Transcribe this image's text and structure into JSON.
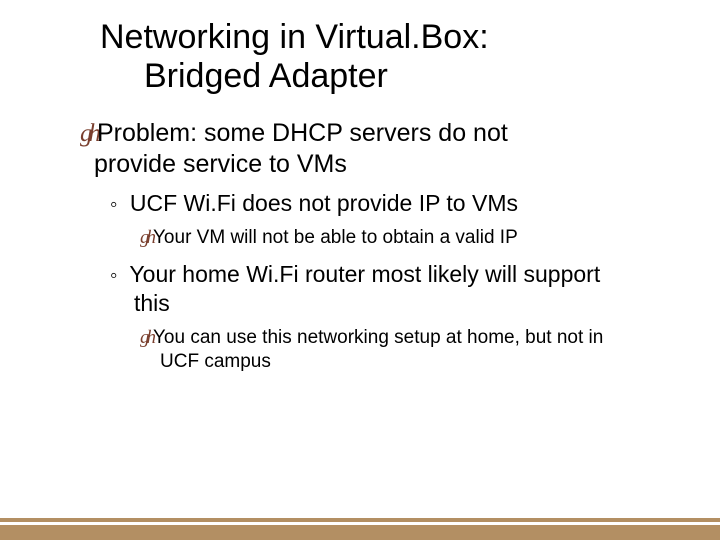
{
  "title": {
    "line1": "Networking in Virtual.Box:",
    "line2": "Bridged Adapter"
  },
  "content": {
    "p1_bullet": "gh",
    "p1_text_a": "Problem: some DHCP servers do not",
    "p1_text_b": "provide service to VMs",
    "p2_bullet": "◦",
    "p2_text": " UCF Wi.Fi does not provide IP to VMs",
    "p3_bullet": "gh",
    "p3_text": "Your VM will not be able to obtain a valid IP",
    "p4_bullet": "◦",
    "p4_text_a": " Your home Wi.Fi router most likely will support",
    "p4_text_b": "this",
    "p5_bullet": "gh",
    "p5_text_a": "You can use this networking setup at home, but not in",
    "p5_text_b": "UCF campus"
  },
  "theme": {
    "accent": "#7a3f2e",
    "brand_stripe": "#b38f63",
    "background": "#ffffff"
  }
}
